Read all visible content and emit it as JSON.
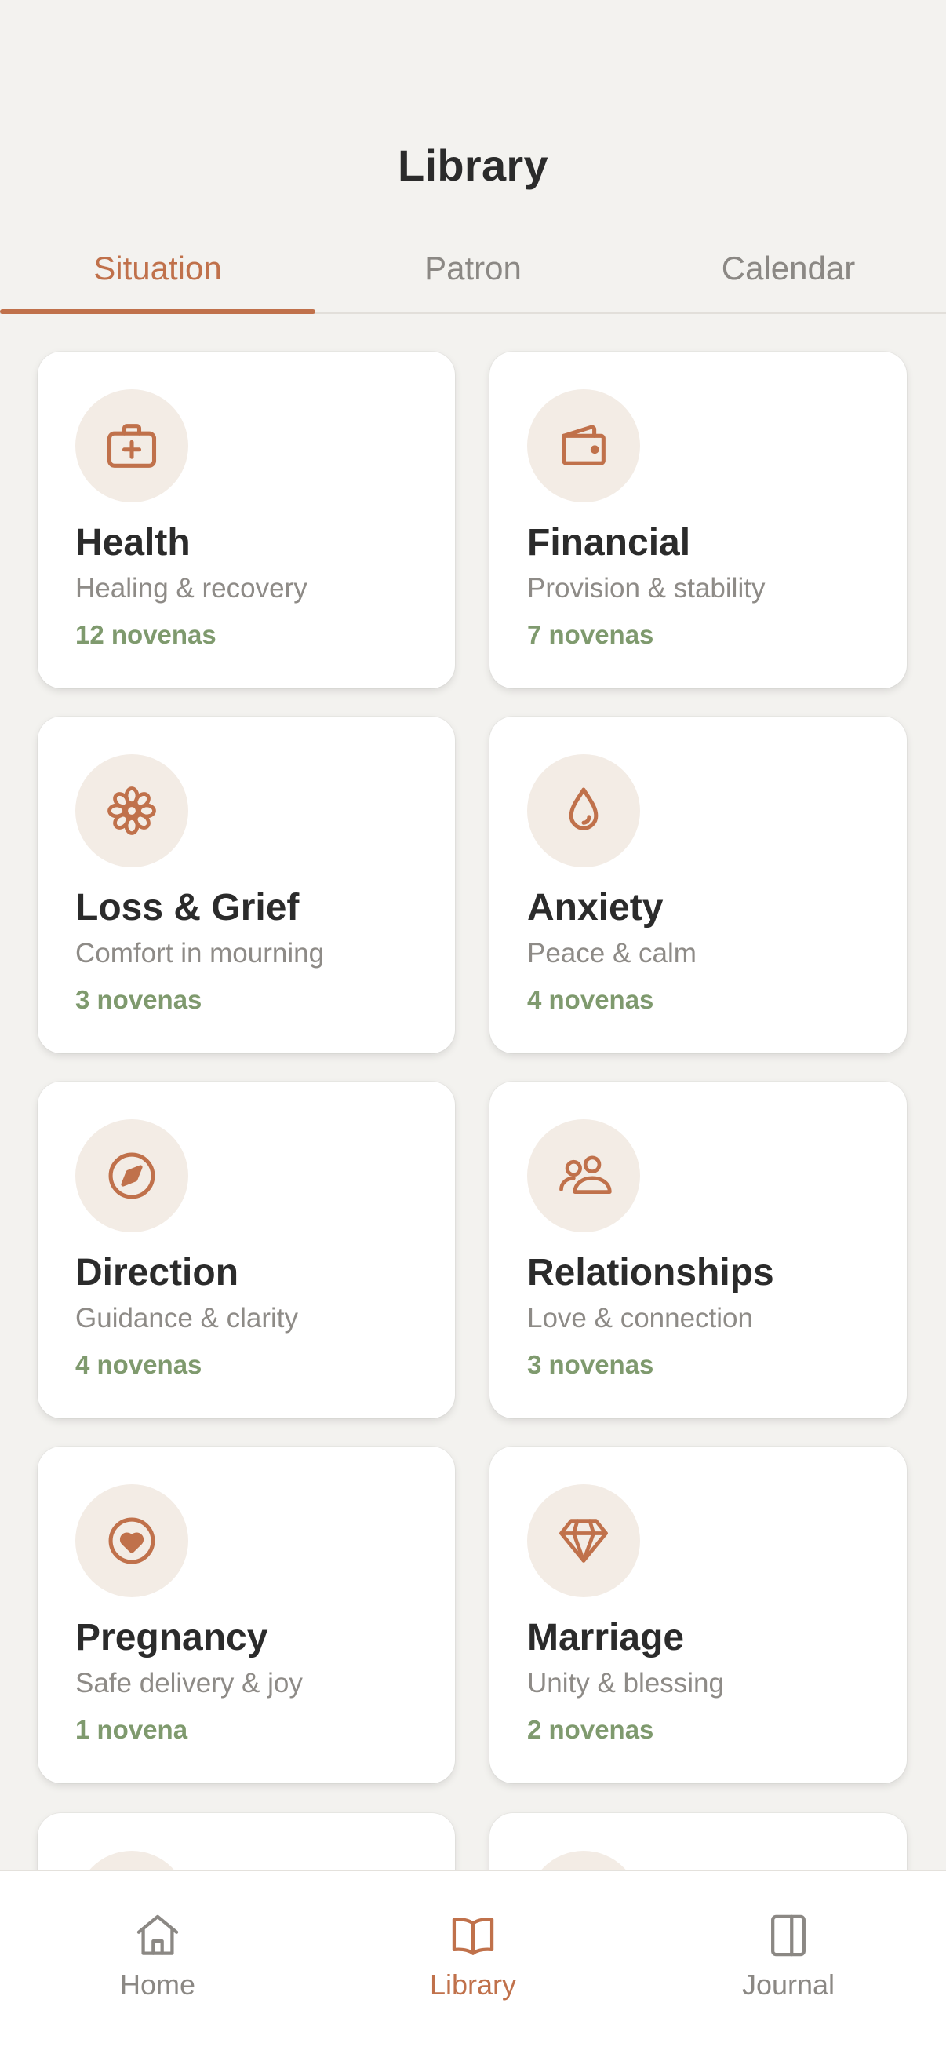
{
  "header": {
    "title": "Library"
  },
  "tabs": [
    {
      "label": "Situation",
      "active": true
    },
    {
      "label": "Patron",
      "active": false
    },
    {
      "label": "Calendar",
      "active": false
    }
  ],
  "cards": [
    {
      "title": "Health",
      "subtitle": "Healing & recovery",
      "count": "12 novenas",
      "icon": "medical-kit-icon"
    },
    {
      "title": "Financial",
      "subtitle": "Provision & stability",
      "count": "7 novenas",
      "icon": "wallet-icon"
    },
    {
      "title": "Loss & Grief",
      "subtitle": "Comfort in mourning",
      "count": "3 novenas",
      "icon": "flower-icon"
    },
    {
      "title": "Anxiety",
      "subtitle": "Peace & calm",
      "count": "4 novenas",
      "icon": "droplet-icon"
    },
    {
      "title": "Direction",
      "subtitle": "Guidance & clarity",
      "count": "4 novenas",
      "icon": "compass-icon"
    },
    {
      "title": "Relationships",
      "subtitle": "Love & connection",
      "count": "3 novenas",
      "icon": "people-icon"
    },
    {
      "title": "Pregnancy",
      "subtitle": "Safe delivery & joy",
      "count": "1 novena",
      "icon": "heart-circle-icon"
    },
    {
      "title": "Marriage",
      "subtitle": "Unity & blessing",
      "count": "2 novenas",
      "icon": "diamond-icon"
    }
  ],
  "nav": [
    {
      "label": "Home",
      "icon": "home-icon",
      "active": false
    },
    {
      "label": "Library",
      "icon": "book-icon",
      "active": true
    },
    {
      "label": "Journal",
      "icon": "journal-icon",
      "active": false
    }
  ],
  "colors": {
    "accent": "#c0714b",
    "count_green": "#7f9a6e",
    "background": "#f3f2ef",
    "icon_bg": "#f3ece5"
  }
}
